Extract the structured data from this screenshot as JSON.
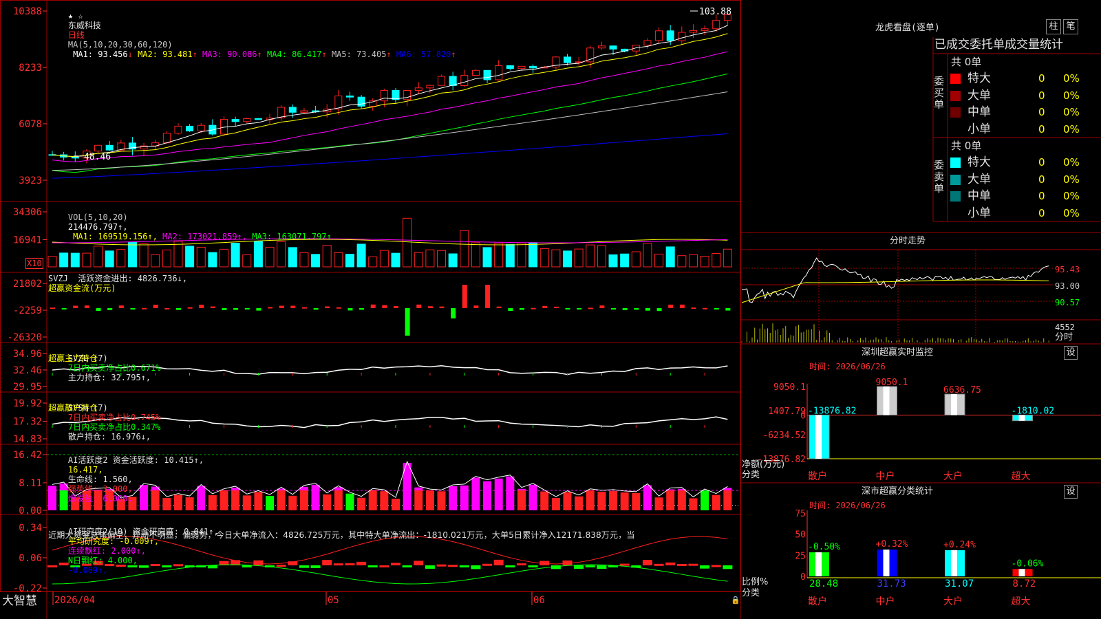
{
  "window": {
    "app_name": "大智慧",
    "symbol": "东威科技",
    "period": "日线",
    "stars": "★ ☆"
  },
  "kline": {
    "ma_params": "MA(5,10,20,30,60,120)",
    "ma": [
      {
        "label": "MA1:",
        "value": "93.456",
        "arrow": "↓",
        "color": "#ffffff"
      },
      {
        "label": "MA2:",
        "value": "93.481",
        "arrow": "↑",
        "color": "#ffff00"
      },
      {
        "label": "MA3:",
        "value": "90.086",
        "arrow": "↑",
        "color": "#ff00ff"
      },
      {
        "label": "MA4:",
        "value": "86.417",
        "arrow": "↑",
        "color": "#00ff00"
      },
      {
        "label": "MA5:",
        "value": "73.405",
        "arrow": "↑",
        "color": "#c0c0c0"
      },
      {
        "label": "MA6:",
        "value": "57.820",
        "arrow": "↑",
        "color": "#0000ff"
      }
    ],
    "y_labels": [
      "10388",
      "8233",
      "6078",
      "3923"
    ],
    "y_values": [
      103.88,
      82.33,
      60.78,
      39.23
    ],
    "high_marker": "103.88",
    "low_marker": "48.46",
    "high_value": 103.88,
    "low_value": 48.46
  },
  "vol": {
    "title": "VOL(5,10,20)",
    "value": "214476.797↑,",
    "ma": [
      {
        "label": "MA1:",
        "value": "169519.156↑,",
        "color": "#ffff00"
      },
      {
        "label": "MA2:",
        "value": "173021.859↑,",
        "color": "#ff00ff"
      },
      {
        "label": "MA3:",
        "value": "163071.797↑",
        "color": "#00ff00"
      }
    ],
    "y_labels": [
      "34306",
      "16941"
    ],
    "y_values": [
      34306,
      16941
    ],
    "multiplier": "X10"
  },
  "svzj": {
    "line1": "SVZJ  活跃资金进出: 4826.736↓,",
    "line2": "超赢资金流(万元)",
    "y_labels": [
      "21802",
      "-2259",
      "-26320"
    ],
    "y_values": [
      21802,
      -2259,
      -26320
    ]
  },
  "svzl": {
    "prefix": "SVZL (7)",
    "part1": "7日内买卖净占比0.671%",
    "part2": "主力持仓: 32.795↑,",
    "line2": "超赢主力持仓",
    "y_labels": [
      "34.96",
      "32.46",
      "29.95"
    ],
    "y_values": [
      34.96,
      32.46,
      29.95
    ]
  },
  "svsh": {
    "prefix": "SVSH (7)",
    "part1": "7日内买卖净占比0.745%",
    "part2": "7日内买卖净占比0.347%",
    "part3": "散户持仓: 16.976↓,",
    "line2": "超赢散户持仓",
    "y_labels": [
      "19.92",
      "17.32",
      "14.83"
    ],
    "y_values": [
      19.92,
      17.32,
      14.83
    ]
  },
  "ai_active": {
    "part1": "AI活跃度2 资金活跃度: 10.415↑,",
    "part2": "16.417,",
    "part3": "生命线: 1.560,",
    "part4": "强势线: 3.000,",
    "part5": "爆发线: 6.000,",
    "y_labels": [
      "16.42",
      "8.11",
      "0.00"
    ],
    "y_values": [
      16.42,
      8.11,
      0.0
    ]
  },
  "ai_research": {
    "part1": "AI研究度2(10) 资金研究度: 0.041↑,",
    "part2": "平均研究度: -0.009↑,",
    "part3": "连续飘红: 2.000↑,",
    "part4": "N日飘红: 4.000,",
    "part5": "-0.009↑,",
    "comment": "近期大资金总体偏空，异动不明显，偏弱势，今日大单净流入：4826.725万元，其中特大单净流出：-1810.021万元，大单5日累计净入12171.838万元，当",
    "y_labels": [
      "0.34",
      "0.06",
      "-0.22"
    ],
    "y_values": [
      0.34,
      0.06,
      -0.22
    ]
  },
  "time_axis": {
    "labels": [
      "2026/04",
      "05",
      "06"
    ]
  },
  "dragon": {
    "title": "龙虎看盘(逐单)",
    "btn_bar": "柱",
    "btn_pen": "笔",
    "header": "已成交委托单成交量统计",
    "buy": {
      "side": "委买单",
      "total": "共 0单",
      "rows": [
        {
          "name": "特大",
          "count": "0",
          "pct": "0%",
          "color": "#ff0000"
        },
        {
          "name": "大单",
          "count": "0",
          "pct": "0%",
          "color": "#a00000"
        },
        {
          "name": "中单",
          "count": "0",
          "pct": "0%",
          "color": "#700000"
        },
        {
          "name": "小单",
          "count": "0",
          "pct": "0%",
          "color": ""
        }
      ]
    },
    "sell": {
      "side": "委卖单",
      "total": "共 0单",
      "rows": [
        {
          "name": "特大",
          "count": "0",
          "pct": "0%",
          "color": "#00ffff"
        },
        {
          "name": "大单",
          "count": "0",
          "pct": "0%",
          "color": "#009999"
        },
        {
          "name": "中单",
          "count": "0",
          "pct": "0%",
          "color": "#007777"
        },
        {
          "name": "小单",
          "count": "0",
          "pct": "0%",
          "color": ""
        }
      ]
    }
  },
  "intraday": {
    "title": "分时走势",
    "price_labels": [
      "95.43",
      "93.00",
      "90.57"
    ],
    "vol_label": "4552",
    "unit_label": "分时"
  },
  "monitor": {
    "title": "深圳超赢实时监控",
    "btn": "设",
    "time": "时间: 2026/06/26",
    "y_labels": [
      "9050.1",
      "1407.79",
      "0",
      "-6234.52",
      "-13876.82"
    ],
    "y_values": [
      9050.1,
      1407.79,
      0,
      -6234.52,
      -13876.82
    ],
    "ylabel1": "净额(万元)",
    "ylabel2": "分类",
    "categories": [
      "散户",
      "中户",
      "大户",
      "超大"
    ],
    "values": [
      -13876.82,
      9050.1,
      6636.75,
      -1810.02
    ],
    "value_labels": [
      "-13876.82",
      "9050.1",
      "6636.75",
      "-1810.02"
    ]
  },
  "classstats": {
    "title": "深市超赢分类统计",
    "btn": "设",
    "time": "时间: 2026/06/26",
    "y_labels": [
      "75",
      "50",
      "25",
      "0"
    ],
    "y_values": [
      75,
      50,
      25,
      0
    ],
    "ylabel1": "比例%",
    "ylabel2": "分类",
    "categories": [
      "散户",
      "中户",
      "大户",
      "超大"
    ],
    "values": [
      28.48,
      31.73,
      31.07,
      8.72
    ],
    "value_labels": [
      "28.48",
      "31.73",
      "31.07",
      "8.72"
    ],
    "change_labels": [
      "-0.50%",
      "+0.32%",
      "+0.24%",
      "-0.06%"
    ]
  },
  "chart_data": {
    "type": "candlestick",
    "dates": [
      "2026/04",
      "05",
      "06"
    ],
    "high": 103.88,
    "low": 48.46,
    "ma": {
      "MA1": 93.456,
      "MA2": 93.481,
      "MA3": 90.086,
      "MA4": 86.417,
      "MA5": 73.405,
      "MA6": 57.82
    },
    "volume": 214476.797
  }
}
